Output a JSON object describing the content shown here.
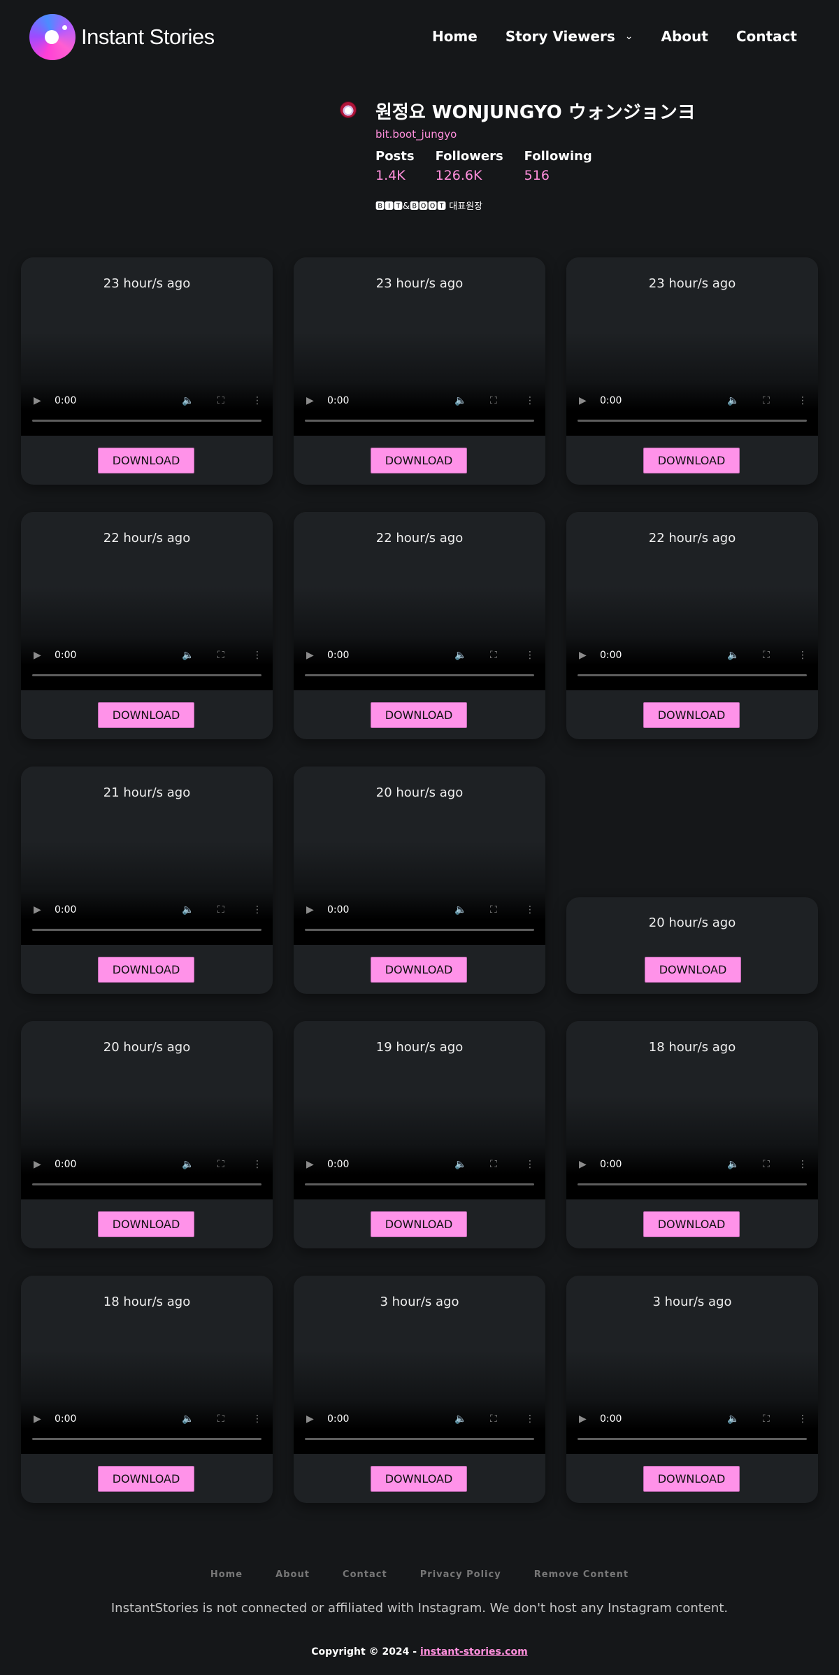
{
  "brand": {
    "name": "Instant Stories"
  },
  "nav": {
    "home": "Home",
    "story_viewers": "Story Viewers",
    "about": "About",
    "contact": "Contact"
  },
  "profile": {
    "name": "원정요 WONJUNGYO ウォンジョンヨ",
    "handle": "bit.boot_jungyo",
    "posts_label": "Posts",
    "posts_value": "1.4K",
    "followers_label": "Followers",
    "followers_value": "126.6K",
    "following_label": "Following",
    "following_value": "516",
    "bio": "🅱🅸🆃&🅱🅾🅾🆃 대표원장"
  },
  "player": {
    "time": "0:00"
  },
  "stories": [
    {
      "time": "23 hour/s ago",
      "type": "video",
      "button": "DOWNLOAD"
    },
    {
      "time": "23 hour/s ago",
      "type": "video",
      "button": "DOWNLOAD"
    },
    {
      "time": "23 hour/s ago",
      "type": "video",
      "button": "DOWNLOAD"
    },
    {
      "time": "22 hour/s ago",
      "type": "video",
      "button": "DOWNLOAD"
    },
    {
      "time": "22 hour/s ago",
      "type": "video",
      "button": "DOWNLOAD"
    },
    {
      "time": "22 hour/s ago",
      "type": "video",
      "button": "DOWNLOAD"
    },
    {
      "time": "21 hour/s ago",
      "type": "video",
      "button": "DOWNLOAD"
    },
    {
      "time": "20 hour/s ago",
      "type": "video",
      "button": "DOWNLOAD"
    },
    {
      "time": "20 hour/s ago",
      "type": "image",
      "button": "DOWNLOAD"
    },
    {
      "time": "20 hour/s ago",
      "type": "video",
      "button": "DOWNLOAD"
    },
    {
      "time": "19 hour/s ago",
      "type": "video",
      "button": "DOWNLOAD"
    },
    {
      "time": "18 hour/s ago",
      "type": "video",
      "button": "DOWNLOAD"
    },
    {
      "time": "18 hour/s ago",
      "type": "video",
      "button": "DOWNLOAD"
    },
    {
      "time": "3 hour/s ago",
      "type": "video",
      "button": "DOWNLOAD"
    },
    {
      "time": "3 hour/s ago",
      "type": "video",
      "button": "DOWNLOAD"
    }
  ],
  "footer": {
    "links": [
      "Home",
      "About",
      "Contact",
      "Privacy Policy",
      "Remove Content"
    ],
    "disclaimer": "InstantStories is not connected or affiliated with Instagram. We don't host any Instagram content.",
    "copyright_prefix": "Copyright © 2024 -",
    "copyright_link": "instant-stories.com"
  }
}
